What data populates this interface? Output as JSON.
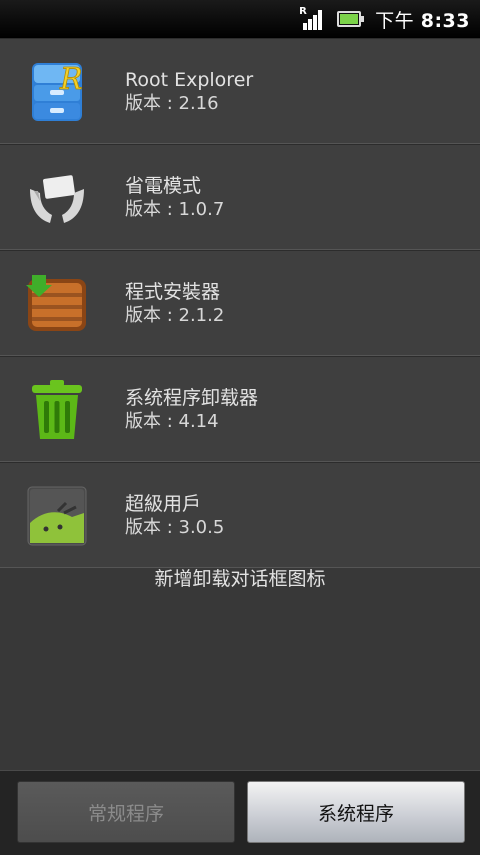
{
  "status_bar": {
    "signal_letter": "R",
    "time_prefix": "下午",
    "time": "8:33",
    "signal_icon": "signal-icon",
    "battery_icon": "battery-icon",
    "battery_color": "#7cd34a"
  },
  "apps": [
    {
      "name": "Root Explorer",
      "version": "版本 : 2.16",
      "icon": "file-cabinet-icon"
    },
    {
      "name": "省電模式",
      "version": "版本 : 1.0.7",
      "icon": "hands-battery-icon"
    },
    {
      "name": "程式安裝器",
      "version": "版本 : 2.1.2",
      "icon": "crate-download-icon"
    },
    {
      "name": "系统程序卸载器",
      "version": "版本 : 4.14",
      "icon": "trash-can-icon"
    },
    {
      "name": "超級用戶",
      "version": "版本 : 3.0.5",
      "icon": "android-superuser-icon"
    }
  ],
  "info_text": "新增卸载对话框图标",
  "tabs": {
    "normal_label": "常规程序",
    "system_label": "系统程序"
  }
}
